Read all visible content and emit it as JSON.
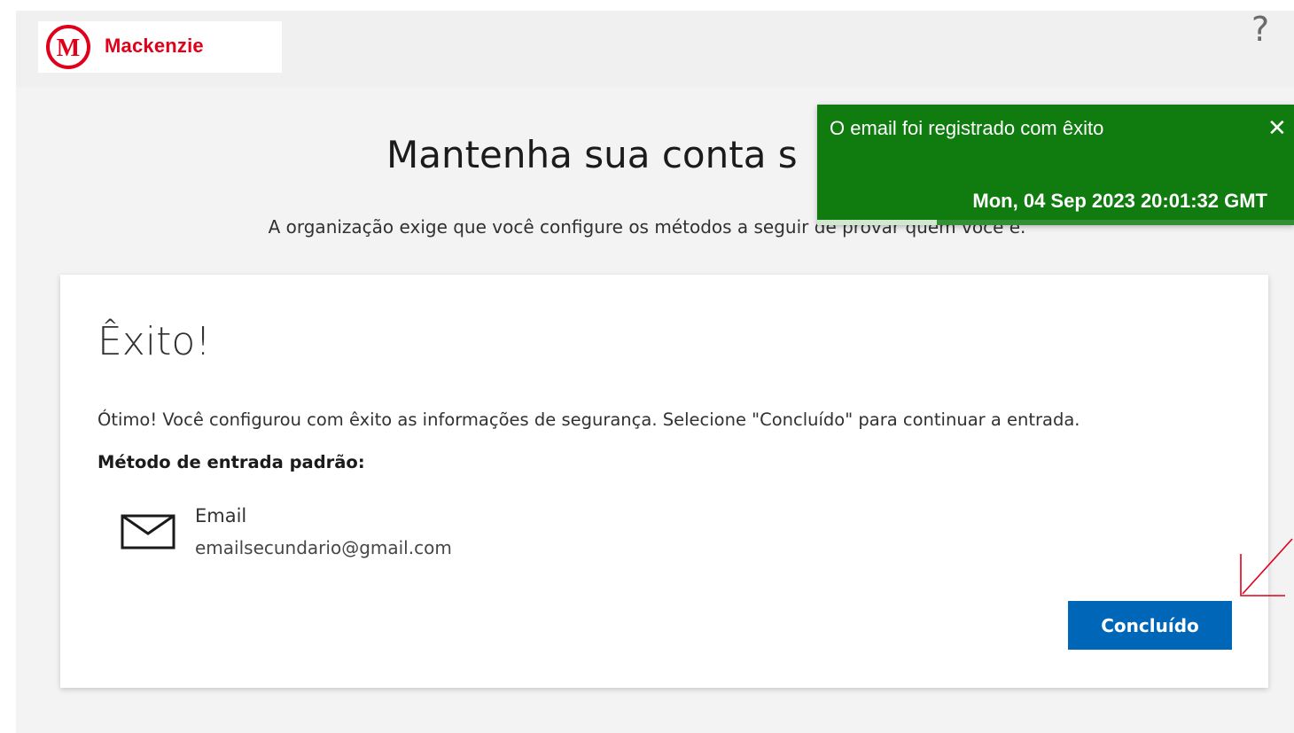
{
  "header": {
    "logo_text": "Mackenzie",
    "logo_mark_letter": "M",
    "brand_color": "#e0001a",
    "help_label": "?"
  },
  "main": {
    "title": "Mantenha sua conta s",
    "subtitle": "A organização exige que você configure os métodos a seguir de provar quem você é."
  },
  "card": {
    "title": "Êxito!",
    "message": "Ótimo! Você configurou com êxito as informações de segurança. Selecione \"Concluído\" para continuar a entrada.",
    "method_heading": "Método de entrada padrão:",
    "method": {
      "icon": "mail-icon",
      "name": "Email",
      "value": "emailsecundario@gmail.com"
    },
    "done_label": "Concluído",
    "done_color": "#0067b8"
  },
  "toast": {
    "message": "O email foi registrado com êxito",
    "close_label": "✕",
    "timestamp": "Mon, 04 Sep 2023 20:01:32 GMT",
    "color": "#107c10",
    "progress": 0.25
  },
  "annotation": {
    "arrow_color": "#e0001a"
  }
}
